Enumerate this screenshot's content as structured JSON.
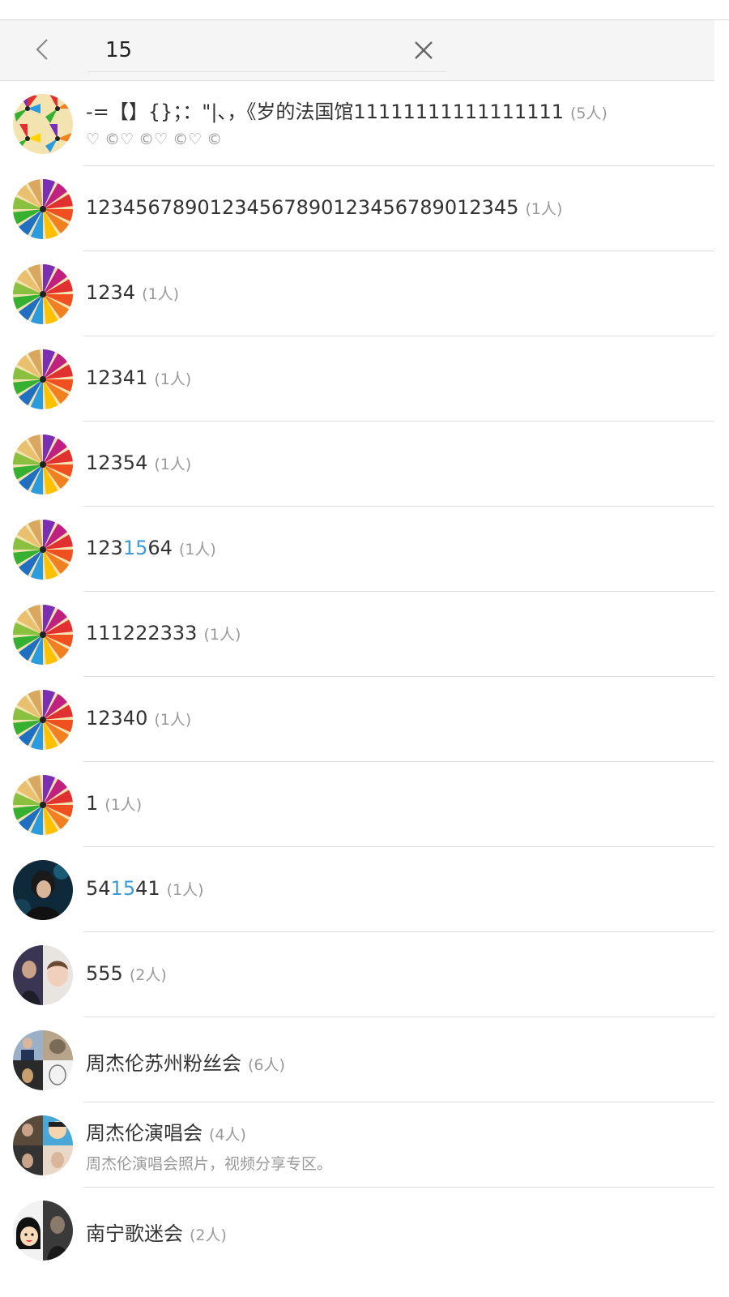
{
  "search": {
    "query": "15"
  },
  "colors": {
    "highlight": "#3a9ad9",
    "count_gray": "#999999"
  },
  "groups": [
    {
      "name": "-=【】{}；：\"|、，《岁的法国馆11111111111111111",
      "count": "(5人)",
      "desc": "♡ ©♡ ©♡ ©♡ ©",
      "avatar": "collage-pencils-icon"
    },
    {
      "name": "12345678901234567890123456789012345",
      "count": "(1人)",
      "avatar": "color-pencils-icon"
    },
    {
      "name": "1234",
      "count": "(1人)",
      "avatar": "color-pencils-icon"
    },
    {
      "name": "12341",
      "count": "(1人)",
      "avatar": "color-pencils-icon"
    },
    {
      "name": "12354",
      "count": "(1人)",
      "avatar": "color-pencils-icon"
    },
    {
      "name_parts": [
        "123",
        "15",
        "64"
      ],
      "count": "(1人)",
      "avatar": "color-pencils-icon"
    },
    {
      "name": "111222333",
      "count": "(1人)",
      "avatar": "color-pencils-icon"
    },
    {
      "name": "12340",
      "count": "(1人)",
      "avatar": "color-pencils-icon"
    },
    {
      "name": "1",
      "count": "(1人)",
      "avatar": "color-pencils-icon"
    },
    {
      "name_parts": [
        "54",
        "15",
        "41"
      ],
      "count": "(1人)",
      "avatar": "singer-photo-icon"
    },
    {
      "name": "555",
      "count": "(2人)",
      "avatar": "two-person-photo-icon"
    },
    {
      "name": "周杰伦苏州粉丝会",
      "count": "(6人)",
      "avatar": "four-photo-collage-icon"
    },
    {
      "name": "周杰伦演唱会",
      "count": "(4人)",
      "desc": "周杰伦演唱会照片，视频分享专区。",
      "avatar": "four-photo-collage-icon"
    },
    {
      "name": "南宁歌迷会",
      "count": "(2人)",
      "avatar": "cartoon-and-photo-icon"
    }
  ]
}
